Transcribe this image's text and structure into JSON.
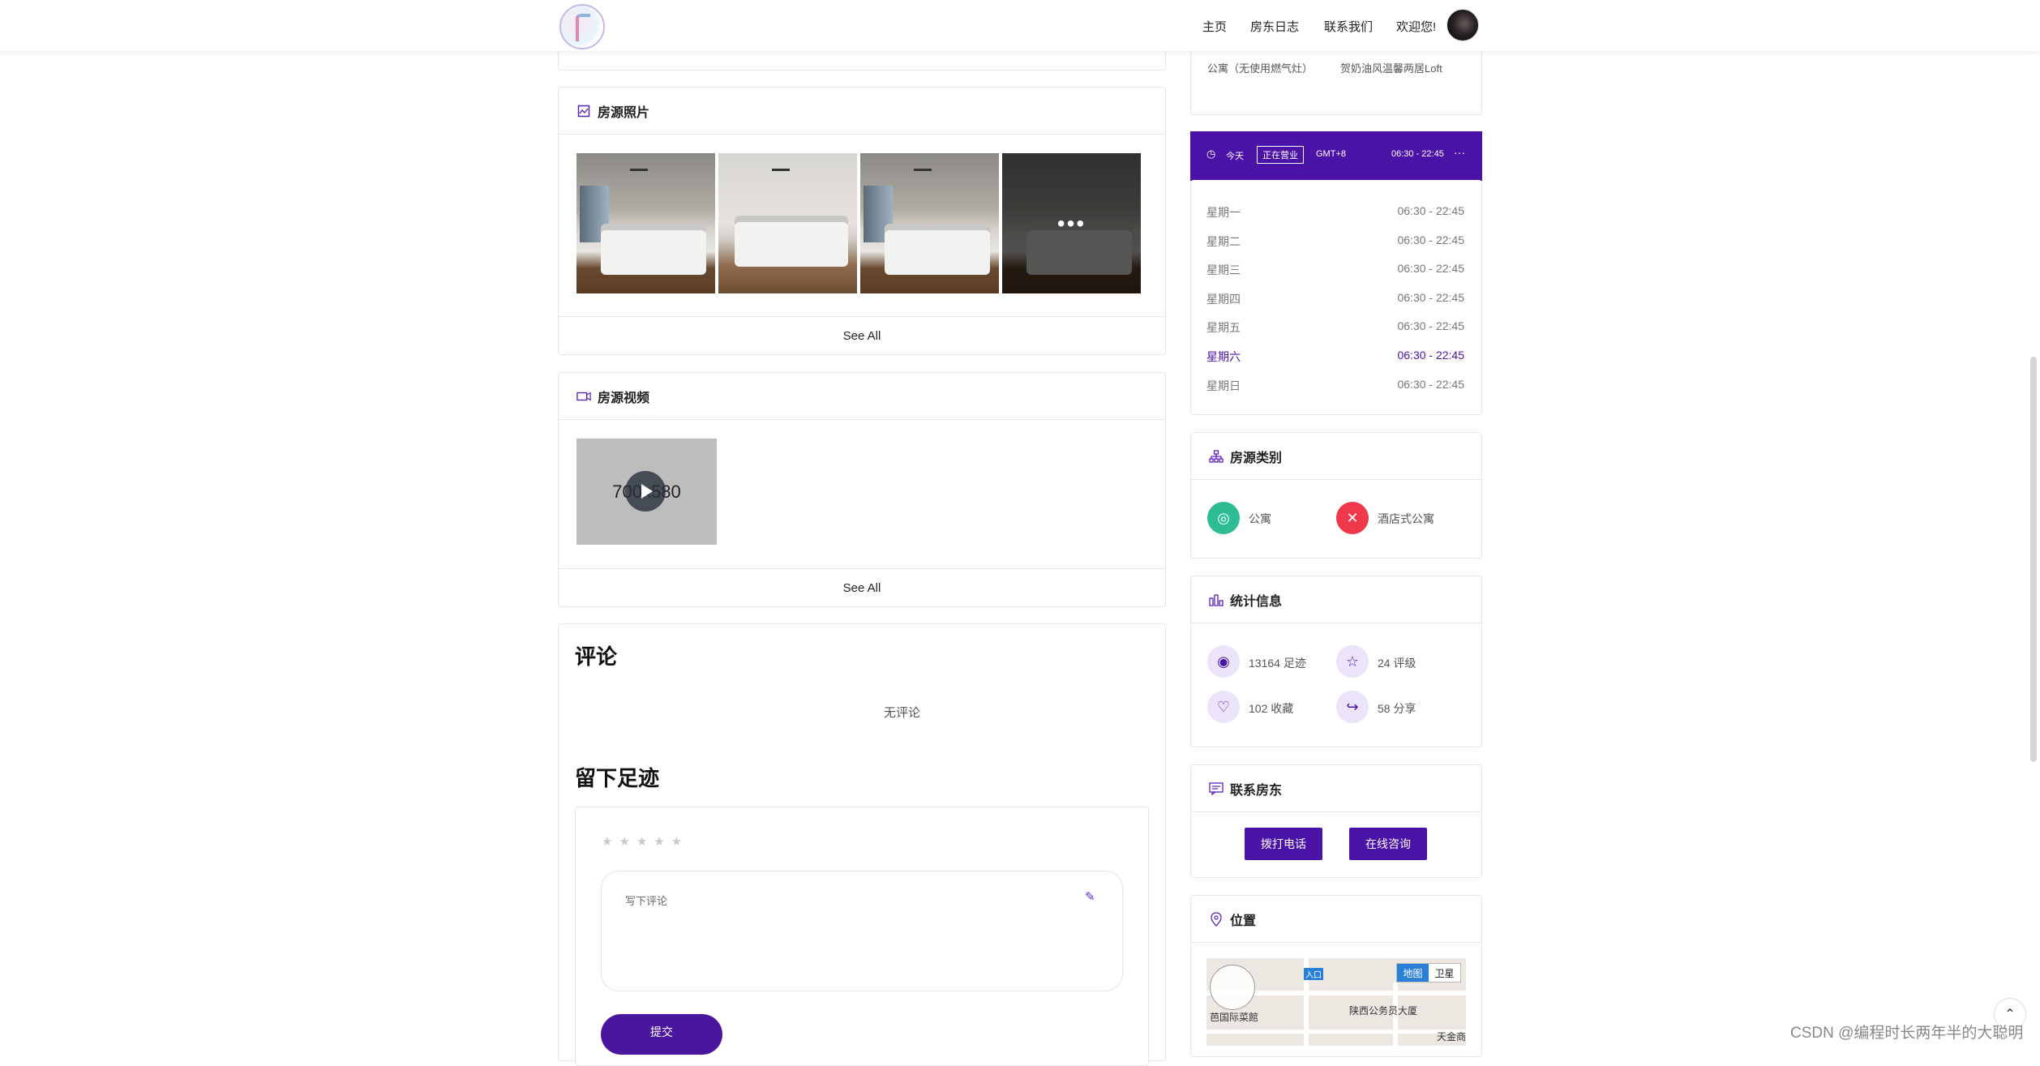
{
  "nav": {
    "items": [
      "主页",
      "房东日志",
      "联系我们"
    ],
    "welcome": "欢迎您!"
  },
  "similar": {
    "left_title": "公寓（无使用燃气灶）",
    "right_title": "贺奶油风温馨两居Loft"
  },
  "photos": {
    "title": "房源照片",
    "see_all": "See All",
    "more": "•••"
  },
  "video": {
    "title": "房源视频",
    "thumb_text": "700x580",
    "see_all": "See All"
  },
  "comments": {
    "title": "评论",
    "empty": "无评论"
  },
  "leave": {
    "title": "留下足迹",
    "stars": "★★★★★",
    "placeholder": "写下评论",
    "submit": "提交"
  },
  "hours": {
    "today": "今天",
    "status": "正在营业",
    "tz": "GMT+8",
    "today_hours": "06:30 - 22:45",
    "more": "···",
    "rows": [
      {
        "day": "星期一",
        "time": "06:30 - 22:45"
      },
      {
        "day": "星期二",
        "time": "06:30 - 22:45"
      },
      {
        "day": "星期三",
        "time": "06:30 - 22:45"
      },
      {
        "day": "星期四",
        "time": "06:30 - 22:45"
      },
      {
        "day": "星期五",
        "time": "06:30 - 22:45"
      },
      {
        "day": "星期六",
        "time": "06:30 - 22:45"
      },
      {
        "day": "星期日",
        "time": "06:30 - 22:45"
      }
    ]
  },
  "category": {
    "title": "房源类别",
    "items": [
      "公寓",
      "酒店式公寓"
    ],
    "colors": [
      "#2ebd93",
      "#f0384b"
    ]
  },
  "stats": {
    "title": "统计信息",
    "views": "13164 足迹",
    "ratings": "24 评级",
    "favorites": "102 收藏",
    "shares": "58 分享"
  },
  "contact": {
    "title": "联系房东",
    "call": "拨打电话",
    "consult": "在线咨询"
  },
  "location": {
    "title": "位置",
    "map_tab": "地图",
    "sat_tab": "卫星",
    "labels": [
      "陕西公务员大厦",
      "天金商",
      "芭国际菜館",
      "入口"
    ]
  },
  "footer": {
    "watermark": "CSDN @编程时长两年半的大聪明"
  },
  "colors": {
    "accent": "#4b12a8",
    "button": "#4b169e"
  }
}
